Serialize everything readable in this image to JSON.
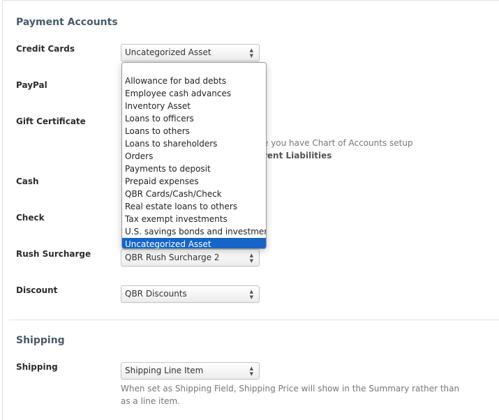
{
  "payment_accounts": {
    "title": "Payment Accounts",
    "credit_cards": {
      "label": "Credit Cards",
      "value": "Uncategorized Asset"
    },
    "paypal": {
      "label": "PayPal"
    },
    "gift_certificate": {
      "label": "Gift Certificate",
      "help_line1": "e you have Chart of Accounts setup",
      "help_line2": "rent Liabilities"
    },
    "cash": {
      "label": "Cash"
    },
    "check": {
      "label": "Check"
    },
    "rush_surcharge": {
      "label": "Rush Surcharge",
      "value": "QBR Rush Surcharge 2"
    },
    "discount": {
      "label": "Discount",
      "value": "QBR Discounts"
    }
  },
  "dropdown": {
    "options": [
      "Allowance for bad debts",
      "Employee cash advances",
      "Inventory Asset",
      "Loans to officers",
      "Loans to others",
      "Loans to shareholders",
      "Orders",
      "Payments to deposit",
      "Prepaid expenses",
      "QBR Cards/Cash/Check",
      "Real estate loans to others",
      "Tax exempt investments",
      "U.S. savings bonds and investments",
      "Uncategorized Asset"
    ],
    "selected": "Uncategorized Asset"
  },
  "shipping": {
    "title": "Shipping",
    "label": "Shipping",
    "value": "Shipping Line Item",
    "help_line1": "When set as Shipping Field, Shipping Price will show in the Summary rather than",
    "help_line2": "as a line item."
  },
  "colors": {
    "selected_bg": "#1565c8",
    "section_title": "#4a5a6a"
  }
}
